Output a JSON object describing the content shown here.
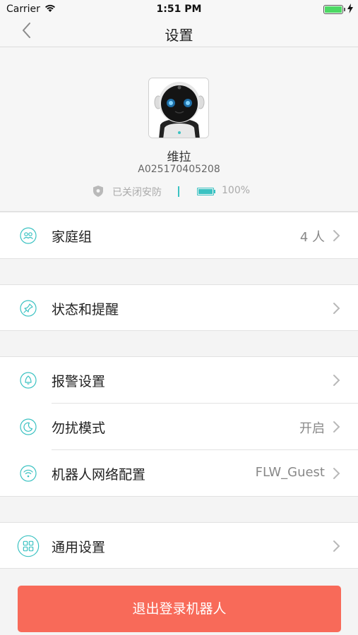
{
  "status_bar": {
    "carrier": "Carrier",
    "time": "1:51 PM",
    "wifi_icon": "wifi-icon",
    "battery_icon": "battery-full-icon",
    "charging_icon": "bolt-icon",
    "battery_color": "#4cd964"
  },
  "nav": {
    "title": "设置",
    "back_icon": "chevron-left-icon"
  },
  "profile": {
    "name": "维拉",
    "id": "A025170405208",
    "security_status": "已关闭安防",
    "battery_percent": "100%",
    "battery_level": 1.0,
    "accent_color": "#3bc2c2"
  },
  "groups": [
    {
      "rows": [
        {
          "label": "家庭组",
          "value": "4 人",
          "icon": "family-icon"
        }
      ]
    },
    {
      "rows": [
        {
          "label": "状态和提醒",
          "value": "",
          "icon": "pin-icon"
        }
      ]
    },
    {
      "rows": [
        {
          "label": "报警设置",
          "value": "",
          "icon": "alarm-bell-icon"
        },
        {
          "label": "勿扰模式",
          "value": "开启",
          "icon": "moon-icon"
        },
        {
          "label": "机器人网络配置",
          "value": "FLW_Guest",
          "icon": "wifi-icon"
        }
      ]
    },
    {
      "rows": [
        {
          "label": "通用设置",
          "value": "",
          "icon": "grid-icon"
        }
      ]
    }
  ],
  "logout": {
    "label": "退出登录机器人",
    "color": "#f86a59"
  }
}
